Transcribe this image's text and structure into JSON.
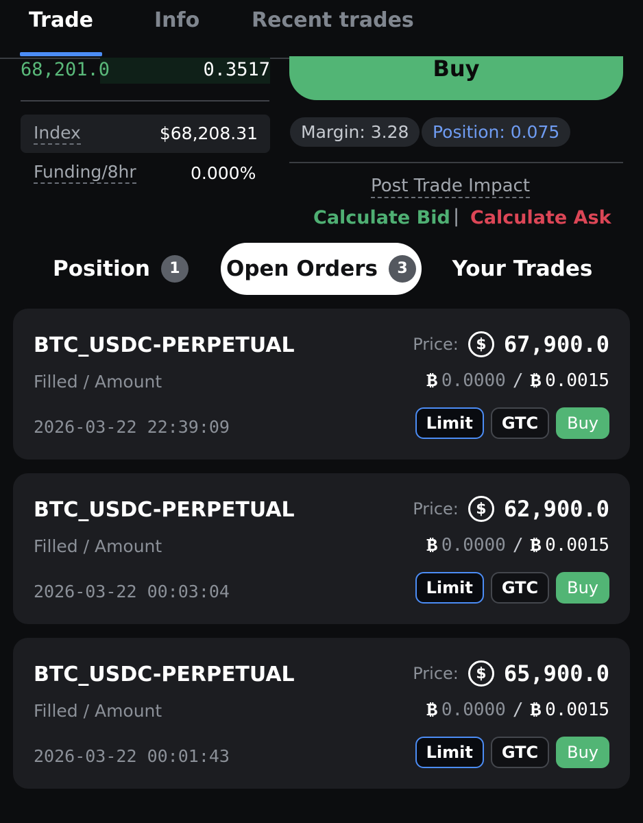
{
  "top_tabs": [
    {
      "label": "Trade",
      "active": true
    },
    {
      "label": "Info",
      "active": false
    },
    {
      "label": "Recent trades",
      "active": false
    }
  ],
  "orderbook": {
    "price": "68,201.0",
    "size": "0.3517"
  },
  "market_stats": {
    "index_label": "Index",
    "index_value": "$68,208.31",
    "funding_label": "Funding/8hr",
    "funding_value": "0.000%"
  },
  "trade_panel": {
    "buy_button": "Buy",
    "margin_chip": "Margin: 3.28",
    "position_chip": "Position: 0.075",
    "post_trade_impact": "Post Trade Impact",
    "calculate_bid": "Calculate Bid",
    "separator": "|",
    "calculate_ask": "Calculate Ask"
  },
  "section_tabs": [
    {
      "label": "Position",
      "count": "1",
      "active": false
    },
    {
      "label": "Open Orders",
      "count": "3",
      "active": true
    },
    {
      "label": "Your Trades",
      "count": null,
      "active": false
    }
  ],
  "orders": [
    {
      "symbol": "BTC_USDC-PERPETUAL",
      "filled_amount_label": "Filled / Amount",
      "timestamp": "2026-03-22 22:39:09",
      "price_label": "Price:",
      "price": "67,900.0",
      "filled": "0.0000",
      "amount": "0.0015",
      "order_type": "Limit",
      "time_in_force": "GTC",
      "side": "Buy"
    },
    {
      "symbol": "BTC_USDC-PERPETUAL",
      "filled_amount_label": "Filled / Amount",
      "timestamp": "2026-03-22 00:03:04",
      "price_label": "Price:",
      "price": "62,900.0",
      "filled": "0.0000",
      "amount": "0.0015",
      "order_type": "Limit",
      "time_in_force": "GTC",
      "side": "Buy"
    },
    {
      "symbol": "BTC_USDC-PERPETUAL",
      "filled_amount_label": "Filled / Amount",
      "timestamp": "2026-03-22 00:01:43",
      "price_label": "Price:",
      "price": "65,900.0",
      "filled": "0.0000",
      "amount": "0.0015",
      "order_type": "Limit",
      "time_in_force": "GTC",
      "side": "Buy"
    }
  ],
  "icons": {
    "currency": "usd-coin-icon",
    "asset": "bitcoin-icon"
  },
  "colors": {
    "buy_green": "#52b575",
    "ask_red": "#dc4656",
    "accent_blue": "#4c8df6",
    "card_bg": "#1c1d21",
    "page_bg": "#0c0d0f"
  }
}
